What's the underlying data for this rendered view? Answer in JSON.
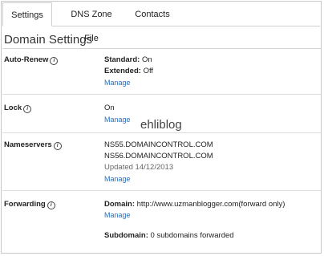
{
  "tabs": [
    "Settings",
    "DNS Zone File",
    "Contacts"
  ],
  "page_title": "Domain Settings",
  "auto_renew": {
    "label": "Auto-Renew",
    "standard_key": "Standard:",
    "standard_value": "On",
    "extended_key": "Extended:",
    "extended_value": "Off",
    "manage": "Manage"
  },
  "lock": {
    "label": "Lock",
    "value": "On",
    "manage": "Manage"
  },
  "watermark": "ehliblog",
  "nameservers": {
    "label": "Nameservers",
    "ns1": "NS55.DOMAINCONTROL.COM",
    "ns2": "NS56.DOMAINCONTROL.COM",
    "updated": "Updated 14/12/2013",
    "manage": "Manage"
  },
  "forwarding": {
    "label": "Forwarding",
    "domain_key": "Domain:",
    "domain_value": "http://www.uzmanblogger.com(forward only)",
    "manage": "Manage",
    "subdomain_key": "Subdomain:",
    "subdomain_value": "0 subdomains forwarded"
  },
  "info_icon_glyph": "i"
}
